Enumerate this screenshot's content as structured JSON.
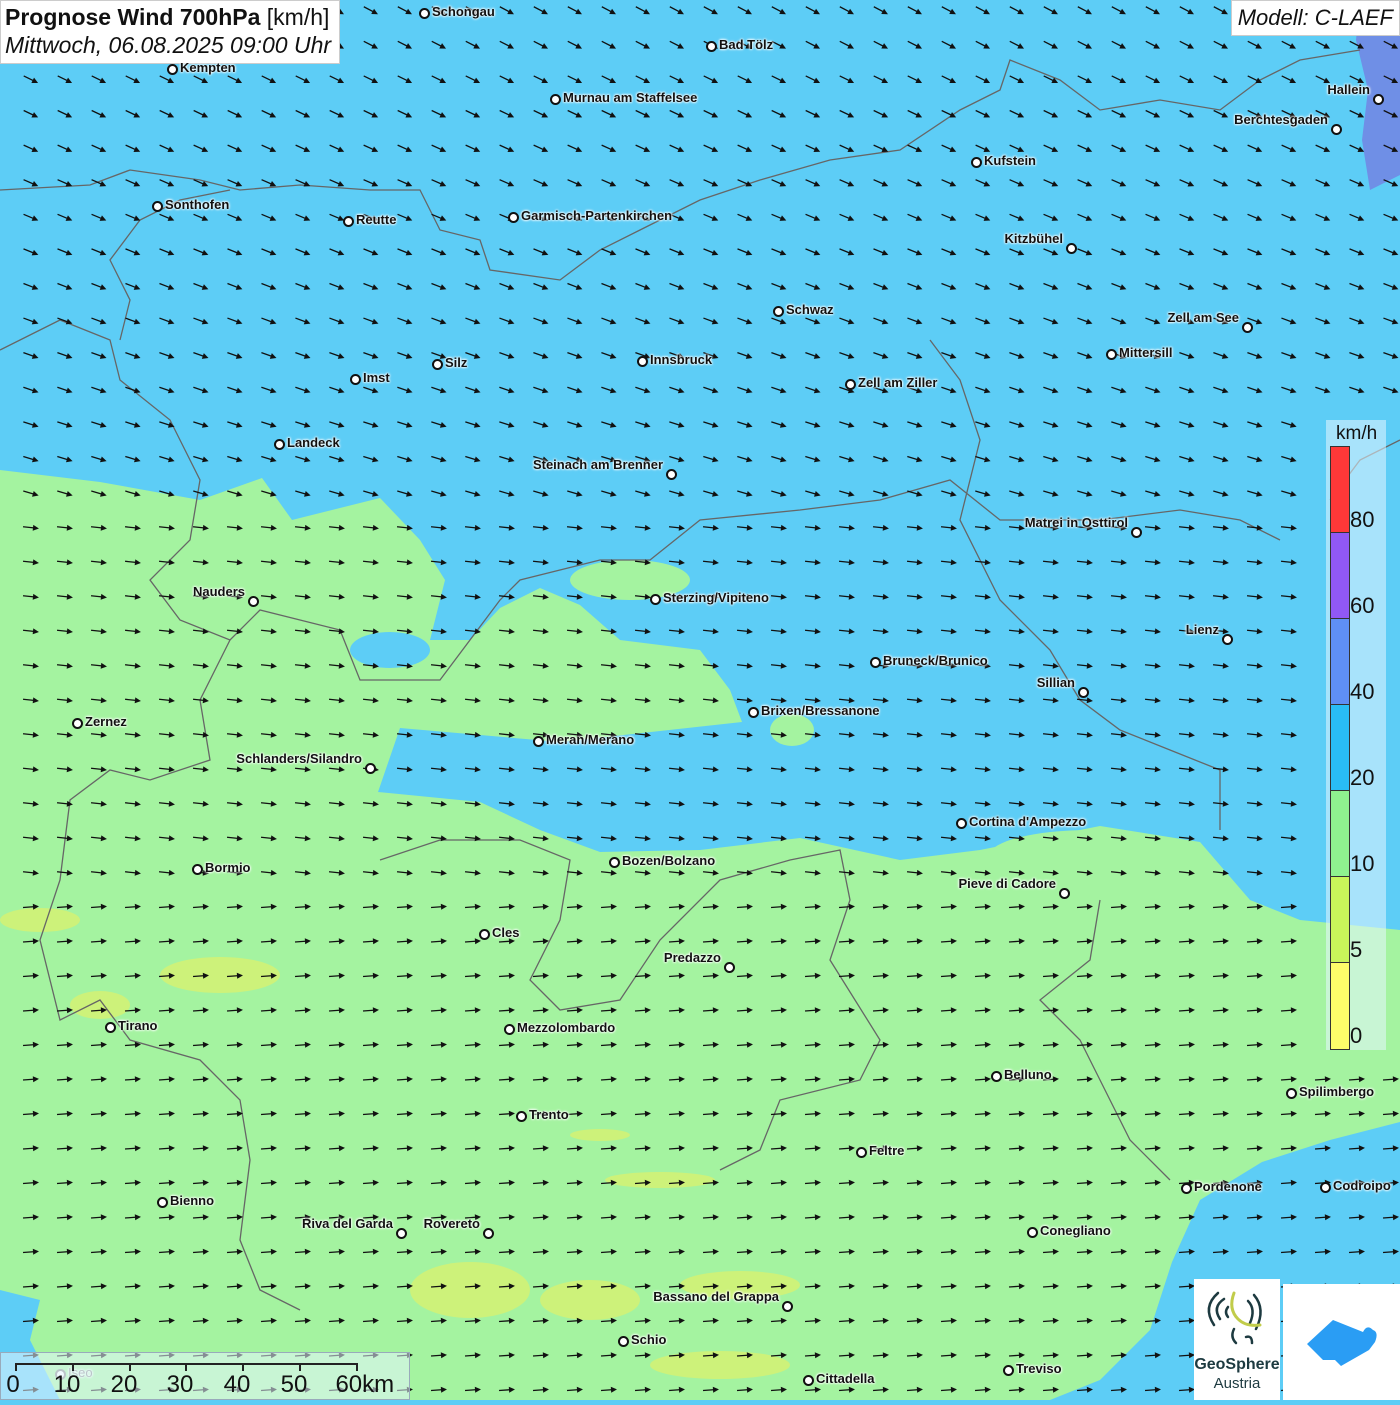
{
  "header": {
    "title_bold": "Prognose Wind 700hPa",
    "title_unit": "[km/h]",
    "datetime": "Mittwoch, 06.08.2025 09:00 Uhr",
    "model": "Modell: C-LAEF"
  },
  "colors": {
    "wind_10_20": "#a4f3a0",
    "wind_20_40": "#5dcdf6",
    "wind_40_60": "#5f8ff5",
    "wind_5_10": "#c8f55a",
    "wind_0_5": "#fcfc6a"
  },
  "legend": {
    "unit": "km/h",
    "classes": [
      {
        "color": "#ff3838"
      },
      {
        "color": "#9158f4"
      },
      {
        "color": "#5f8ff5"
      },
      {
        "color": "#29bdf5"
      },
      {
        "color": "#8ff28f"
      },
      {
        "color": "#c8f55a"
      },
      {
        "color": "#fdfd6a"
      }
    ],
    "ticks": [
      "80",
      "60",
      "40",
      "20",
      "10",
      "5",
      "0"
    ]
  },
  "scale_bar": {
    "ticks": [
      "0",
      "10",
      "20",
      "30",
      "40",
      "50",
      "60km"
    ]
  },
  "cities": [
    "Schongau",
    "Bad Tölz",
    "Kempten",
    "Murnau am Staffelsee",
    "Hallein",
    "Berchtesgaden",
    "Kufstein",
    "Sonthofen",
    "Reutte",
    "Garmisch-Partenkirchen",
    "Kitzbühel",
    "Schwaz",
    "Zell am See",
    "Mittersill",
    "Innsbruck",
    "Silz",
    "Imst",
    "Zell am Ziller",
    "Landeck",
    "Steinach am Brenner",
    "Matrei in Osttirol",
    "Nauders",
    "Sterzing/Vipiteno",
    "Lienz",
    "Bruneck/Brunico",
    "Sillian",
    "Zernez",
    "Brixen/Bressanone",
    "Meran/Merano",
    "Schlanders/Silandro",
    "Cortina d'Ampezzo",
    "Bozen/Bolzano",
    "Bormio",
    "Pieve di Cadore",
    "Cles",
    "Predazzo",
    "Tirano",
    "Mezzolombardo",
    "Belluno",
    "Spilimbergo",
    "Trento",
    "Feltre",
    "Pordenone",
    "Codroipo",
    "Bienno",
    "Riva del Garda",
    "Rovereto",
    "Conegliano",
    "Bassano del Grappa",
    "Schio",
    "Treviso",
    "Cittadella",
    "Iseo"
  ],
  "logos": {
    "geosphere_line1": "GeoSphere",
    "geosphere_line2": "Austria"
  }
}
